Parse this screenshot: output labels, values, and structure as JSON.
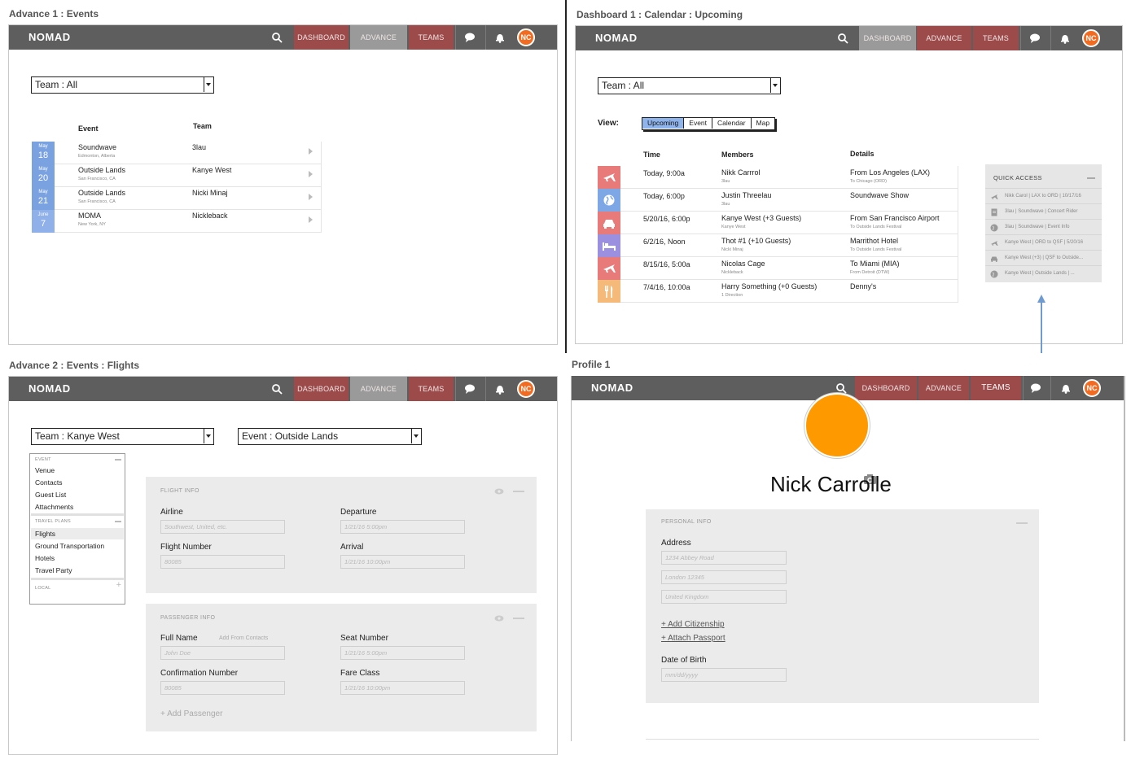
{
  "navbar": {
    "logo": "NOMAD",
    "dashboard": "DASHBOARD",
    "advance": "ADVANCE",
    "teams": "TEAMS",
    "avatar_initials": "NC"
  },
  "screen1": {
    "caption": "Advance 1 : Events",
    "team_select": "Team : All",
    "col_event": "Event",
    "col_team": "Team",
    "events": [
      {
        "month": "May",
        "day": "18",
        "name": "Soundwave",
        "location": "Edmonton, Alberta",
        "team": "3lau"
      },
      {
        "month": "May",
        "day": "20",
        "name": "Outside Lands",
        "location": "San Francisco, CA",
        "team": "Kanye West"
      },
      {
        "month": "May",
        "day": "21",
        "name": "Outside Lands",
        "location": "San Francisco, CA",
        "team": "Nicki Minaj"
      },
      {
        "month": "June",
        "day": "7",
        "name": "MOMA",
        "location": "New York, NY",
        "team": "Nickleback"
      }
    ]
  },
  "screen2": {
    "caption": "Dashboard 1 : Calendar : Upcoming",
    "team_select": "Team : All",
    "view_label": "View:",
    "views": [
      "Upcoming",
      "Event",
      "Calendar",
      "Map"
    ],
    "active_view": "Upcoming",
    "col_time": "Time",
    "col_members": "Members",
    "col_details": "Details",
    "rows": [
      {
        "icon": "plane-icon",
        "color": "#e87a7a",
        "time": "Today, 9:00a",
        "member": "Nikk Carrrol",
        "member_sub": "3lau",
        "detail": "From Los Angeles (LAX)",
        "detail_sub": "To Chicago (ORD)"
      },
      {
        "icon": "globe-icon",
        "color": "#7ea7e6",
        "time": "Today, 6:00p",
        "member": "Justin Threelau",
        "member_sub": "3lau",
        "detail": "Soundwave Show",
        "detail_sub": ""
      },
      {
        "icon": "car-icon",
        "color": "#e87a7a",
        "time": "5/20/16, 6:00p",
        "member": "Kanye West (+3 Guests)",
        "member_sub": "Kanye West",
        "detail": "From San Francisco Airport",
        "detail_sub": "To Outside Lands Festival"
      },
      {
        "icon": "bed-icon",
        "color": "#9b8fe0",
        "time": "6/2/16, Noon",
        "member": "Thot #1 (+10 Guests)",
        "member_sub": "Nicki Minaj",
        "detail": "Marrithot Hotel",
        "detail_sub": "To Outside Lands Festival"
      },
      {
        "icon": "plane-icon",
        "color": "#e87a7a",
        "time": "8/15/16, 5:00a",
        "member": "Nicolas Cage",
        "member_sub": "Nickleback",
        "detail": "To Miami (MIA)",
        "detail_sub": "From Detroit (DTW)"
      },
      {
        "icon": "fork-knife-icon",
        "color": "#f5b97a",
        "time": "7/4/16, 10:00a",
        "member": "Harry Something (+0 Guests)",
        "member_sub": "1 Direction",
        "detail": "Denny's",
        "detail_sub": ""
      }
    ],
    "quick_access": {
      "title": "QUICK ACCESS",
      "items": [
        {
          "icon": "plane-icon",
          "label": "Nikk Carol | LAX to ORD | 10/17/16"
        },
        {
          "icon": "document-icon",
          "label": "3lau | Soundwave | Concert Rider"
        },
        {
          "icon": "globe-icon",
          "label": "3lau | Soundwave | Event Info"
        },
        {
          "icon": "plane-icon",
          "label": "Kanye West | ORD to QSF | 5/20/16"
        },
        {
          "icon": "car-icon",
          "label": "Kanye West (+3) | QSF to Outside..."
        },
        {
          "icon": "globe-icon",
          "label": "Kanye West | Outside Lands | ..."
        }
      ]
    }
  },
  "screen3": {
    "caption": "Advance 2 : Events : Flights",
    "team_select": "Team : Kanye West",
    "event_select": "Event : Outside Lands",
    "sidenav": {
      "event_head": "EVENT",
      "event_items": [
        "Venue",
        "Contacts",
        "Guest List",
        "Attachments"
      ],
      "travel_head": "TRAVEL PLANS",
      "travel_items": [
        "Flights",
        "Ground Transportation",
        "Hotels",
        "Travel Party"
      ],
      "local_head": "LOCAL"
    },
    "flight": {
      "title": "FLIGHT INFO",
      "airline_label": "Airline",
      "airline_placeholder": "Southwest, United, etc.",
      "departure_label": "Departure",
      "departure_placeholder": "1/21/16 5:00pm",
      "flight_number_label": "Flight Number",
      "flight_number_placeholder": "80085",
      "arrival_label": "Arrival",
      "arrival_placeholder": "1/21/16 10:00pm"
    },
    "passenger": {
      "title": "PASSENGER INFO",
      "full_name_label": "Full Name",
      "add_from_contacts": "Add From Contacts",
      "full_name_placeholder": "John Doe",
      "seat_label": "Seat Number",
      "seat_placeholder": "1/21/16 5:00pm",
      "confirmation_label": "Confirmation Number",
      "confirmation_placeholder": "80085",
      "fare_label": "Fare Class",
      "fare_placeholder": "1/21/16 10:00pm",
      "add_passenger": "+ Add Passenger"
    }
  },
  "screen4": {
    "caption": "Profile 1",
    "name": "Nick Carrolle",
    "panel_title": "PERSONAL INFO",
    "address_label": "Address",
    "address_line1": "1234 Abbey Road",
    "address_line2": "London 12345",
    "address_line3": "United Kingdom",
    "add_citizenship": "+ Add Citizenship",
    "attach_passport": "+ Attach Passport",
    "dob_label": "Date of Birth",
    "dob_placeholder": "mm/dd/yyyy"
  }
}
